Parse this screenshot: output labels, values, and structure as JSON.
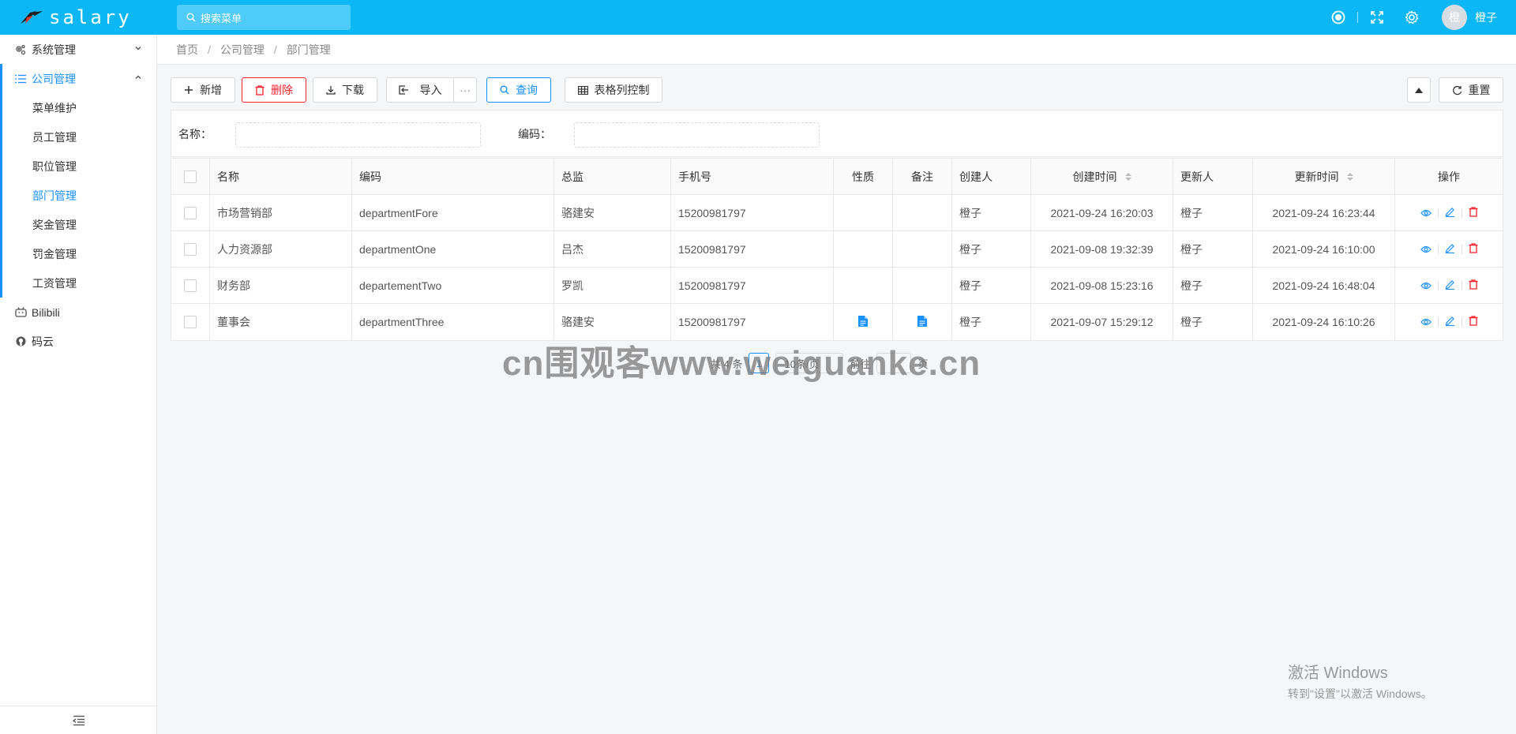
{
  "app": {
    "name": "salary"
  },
  "header": {
    "search_placeholder": "搜索菜单",
    "user_avatar": "橙",
    "user_name": "橙子"
  },
  "sidebar": {
    "groups": [
      {
        "label": "系统管理",
        "icon": "gears-icon"
      },
      {
        "label": "公司管理",
        "icon": "list-icon",
        "items": [
          "菜单维护",
          "员工管理",
          "职位管理",
          "部门管理",
          "奖金管理",
          "罚金管理",
          "工资管理"
        ],
        "active": "部门管理"
      },
      {
        "label": "Bilibili",
        "icon": "bilibili-icon"
      },
      {
        "label": "码云",
        "icon": "github-icon"
      }
    ]
  },
  "breadcrumb": [
    "首页",
    "公司管理",
    "部门管理"
  ],
  "toolbar": {
    "add": "新增",
    "delete": "删除",
    "download": "下载",
    "import": "导入",
    "more": "···",
    "query": "查询",
    "columns": "表格列控制",
    "reset": "重置"
  },
  "search_form": {
    "name_label": "名称：",
    "code_label": "编码："
  },
  "table": {
    "columns": [
      "名称",
      "编码",
      "总监",
      "手机号",
      "性质",
      "备注",
      "创建人",
      "创建时间",
      "更新人",
      "更新时间",
      "操作"
    ],
    "rows": [
      {
        "name": "市场营销部",
        "code": "departmentFore",
        "director": "骆建安",
        "phone": "15200981797",
        "nature": "",
        "remark": "",
        "creator": "橙子",
        "created": "2021-09-24 16:20:03",
        "updater": "橙子",
        "updated": "2021-09-24 16:23:44"
      },
      {
        "name": "人力资源部",
        "code": "departmentOne",
        "director": "吕杰",
        "phone": "15200981797",
        "nature": "",
        "remark": "",
        "creator": "橙子",
        "created": "2021-09-08 19:32:39",
        "updater": "橙子",
        "updated": "2021-09-24 16:10:00"
      },
      {
        "name": "财务部",
        "code": "departementTwo",
        "director": "罗凯",
        "phone": "15200981797",
        "nature": "",
        "remark": "",
        "creator": "橙子",
        "created": "2021-09-08 15:23:16",
        "updater": "橙子",
        "updated": "2021-09-24 16:48:04"
      },
      {
        "name": "董事会",
        "code": "departmentThree",
        "director": "骆建安",
        "phone": "15200981797",
        "nature": "file-icon",
        "remark": "file-icon",
        "creator": "橙子",
        "created": "2021-09-07 15:29:12",
        "updater": "橙子",
        "updated": "2021-09-24 16:10:26"
      }
    ]
  },
  "pagination": {
    "total": "共 4 条",
    "current_page": "1",
    "page_size": "10条/页",
    "goto": "前往",
    "page_unit": "页"
  },
  "overlay": {
    "watermark": "cn围观客www.weiguanke.cn",
    "activate_title": "激活 Windows",
    "activate_sub": "转到\"设置\"以激活 Windows。"
  },
  "colors": {
    "header": "#0bb7f5",
    "primary": "#1890ff",
    "danger": "#f5222d"
  }
}
